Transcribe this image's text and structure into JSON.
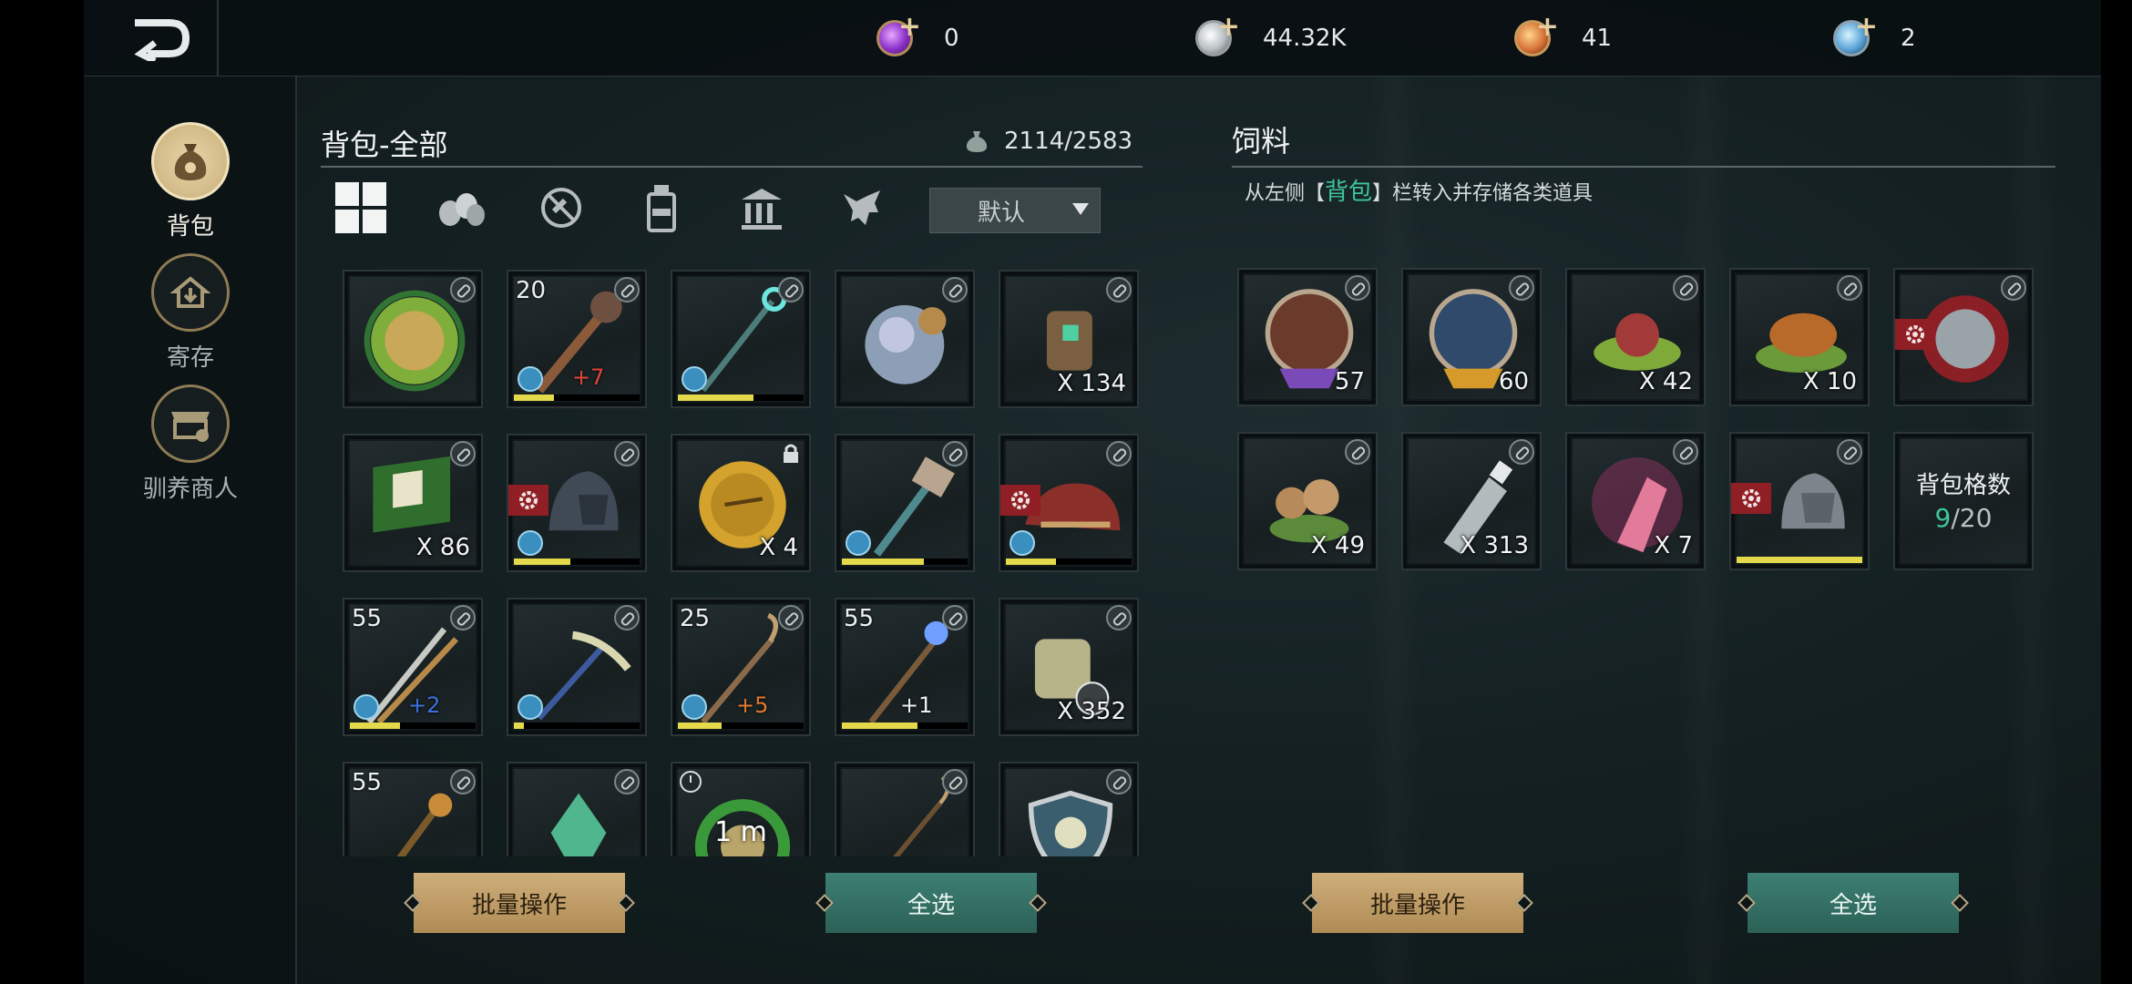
{
  "topbar": {
    "currencies": [
      {
        "icon": "purple-gem-icon",
        "value": "0",
        "color": "#a24fd6"
      },
      {
        "icon": "silver-coin-icon",
        "value": "44.32K",
        "color": "#c9ced0"
      },
      {
        "icon": "red-gold-coin-icon",
        "value": "41",
        "color": "#d8743a"
      },
      {
        "icon": "blue-crystal-icon",
        "value": "2",
        "color": "#5aa4d8"
      }
    ]
  },
  "nav": {
    "items": [
      {
        "label": "背包",
        "icon": "bag-icon",
        "active": true
      },
      {
        "label": "寄存",
        "icon": "storage-house-icon",
        "active": false
      },
      {
        "label": "驯养商人",
        "icon": "merchant-shop-icon",
        "active": false
      }
    ]
  },
  "bag": {
    "title": "背包-全部",
    "capacity": "2114/2583",
    "sort_label": "默认",
    "filters": [
      "all-grid-icon",
      "materials-icon",
      "no-equipment-icon",
      "potion-bottle-icon",
      "bank-building-icon",
      "pet-dragon-icon"
    ],
    "slots": [
      {
        "art": "green-coin-icon",
        "link": true
      },
      {
        "art": "spiked-club-icon",
        "link": true,
        "level": "20",
        "enh": "+7",
        "enh_color": "#e0463a",
        "armor": true,
        "bar": 0.32
      },
      {
        "art": "cyan-staff-icon",
        "link": true,
        "armor": true,
        "bar": 0.6
      },
      {
        "art": "shell-orb-icon",
        "link": true
      },
      {
        "art": "gem-gauntlet-icon",
        "link": true,
        "count": "X 134"
      },
      {
        "art": "green-book-icon",
        "link": true,
        "count": "X 86"
      },
      {
        "art": "dark-helmet-icon",
        "link": true,
        "gear": true,
        "armor": true,
        "bar": 0.45
      },
      {
        "art": "gold-coin-icon",
        "lock": true,
        "count": "X 4"
      },
      {
        "art": "hammer-icon",
        "link": true,
        "armor": true,
        "bar": 0.65
      },
      {
        "art": "red-saddle-icon",
        "link": true,
        "gear": true,
        "armor": true,
        "bar": 0.4
      },
      {
        "art": "twin-swords-icon",
        "link": true,
        "level": "55",
        "enh": "+2",
        "enh_color": "#3d6fe0",
        "armor": true,
        "bar": 0.4
      },
      {
        "art": "pickaxe-icon",
        "link": true,
        "armor": true,
        "bar": 0.08
      },
      {
        "art": "hook-staff-icon",
        "link": true,
        "level": "25",
        "enh": "+5",
        "enh_color": "#e07a2e",
        "armor": true,
        "bar": 0.35
      },
      {
        "art": "blue-orb-staff-icon",
        "link": true,
        "level": "55",
        "enh": "+1",
        "enh_color": "#eef1f1",
        "bar": 0.6
      },
      {
        "art": "map-scroll-icon",
        "link": true,
        "count": "X 352"
      },
      {
        "art": "ornate-staff-icon",
        "link": true,
        "level": "55"
      },
      {
        "art": "green-crystal-icon",
        "link": true
      },
      {
        "art": "green-wreath-icon",
        "timer": true,
        "center": "1 m"
      },
      {
        "art": "thin-staff-icon",
        "link": true
      },
      {
        "art": "shield-emblem-icon",
        "link": true
      }
    ]
  },
  "feed": {
    "title": "饲料",
    "hint_prefix": "从左侧【",
    "hint_accent": "背包",
    "hint_suffix": "】栏转入并存储各类道具",
    "slots": [
      {
        "art": "red-dragon-badge-icon",
        "link": true,
        "count": "57"
      },
      {
        "art": "blue-dragon-badge-icon",
        "link": true,
        "count": "60"
      },
      {
        "art": "red-jam-food-icon",
        "link": true,
        "count": "X 42"
      },
      {
        "art": "roast-meat-icon",
        "link": true,
        "count": "X 10"
      },
      {
        "art": "red-seal-icon",
        "link": true,
        "gear": true
      },
      {
        "art": "mushrooms-icon",
        "link": true,
        "count": "X 49"
      },
      {
        "art": "salt-bottle-icon",
        "link": true,
        "count": "X 313"
      },
      {
        "art": "pink-potion-icon",
        "link": true,
        "count": "X 7"
      },
      {
        "art": "gray-helmet-icon",
        "link": true,
        "gear": true,
        "bar": 1.0
      }
    ],
    "capacity_label": "背包格数",
    "capacity_used": "9",
    "capacity_total": "/20"
  },
  "buttons": {
    "bag_batch": "批量操作",
    "bag_select_all": "全选",
    "feed_batch": "批量操作",
    "feed_select_all": "全选"
  }
}
